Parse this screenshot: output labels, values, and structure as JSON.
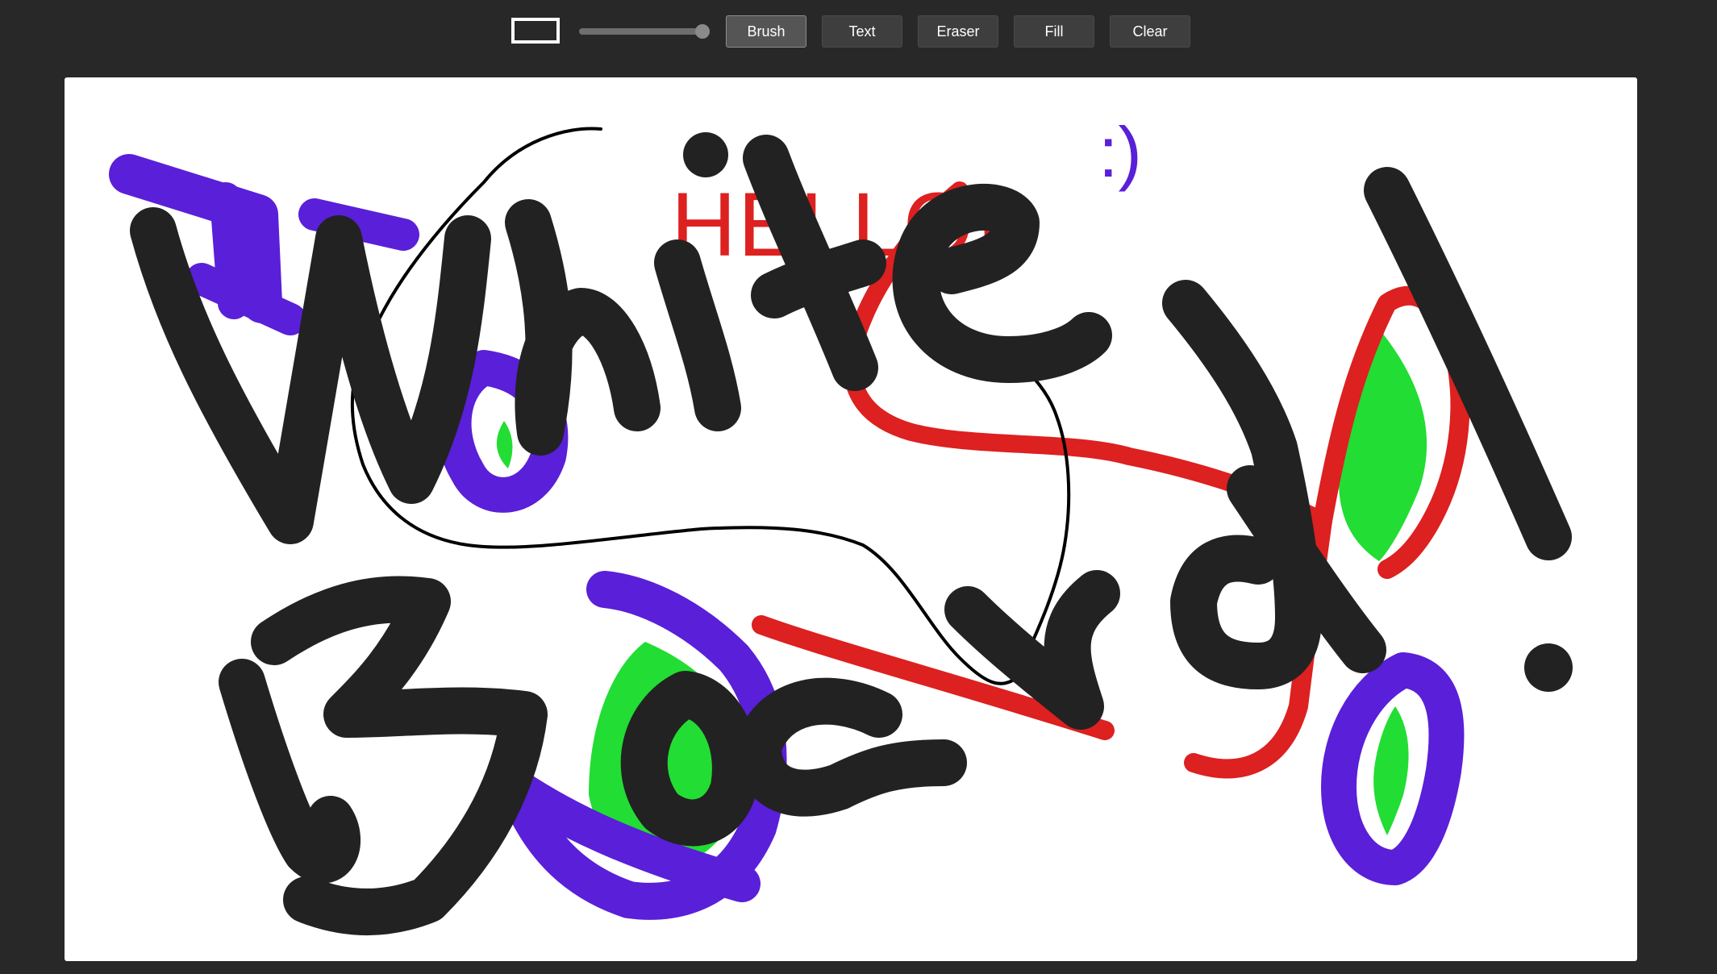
{
  "toolbar": {
    "color_swatch_icon": "color-swatch-icon",
    "brush_size_percent": 95,
    "buttons": [
      {
        "label": "Brush",
        "active": true
      },
      {
        "label": "Text",
        "active": false
      },
      {
        "label": "Eraser",
        "active": false
      },
      {
        "label": "Fill",
        "active": false
      },
      {
        "label": "Clear",
        "active": false
      }
    ]
  },
  "canvas": {
    "background": "#ffffff",
    "texts": {
      "hello": "HELLO!",
      "smiley": ":)"
    },
    "colors": {
      "ink": "#222222",
      "red": "#dd2020",
      "purple": "#5a1fd8",
      "green": "#22dd33",
      "thin_black": "#000000"
    }
  }
}
